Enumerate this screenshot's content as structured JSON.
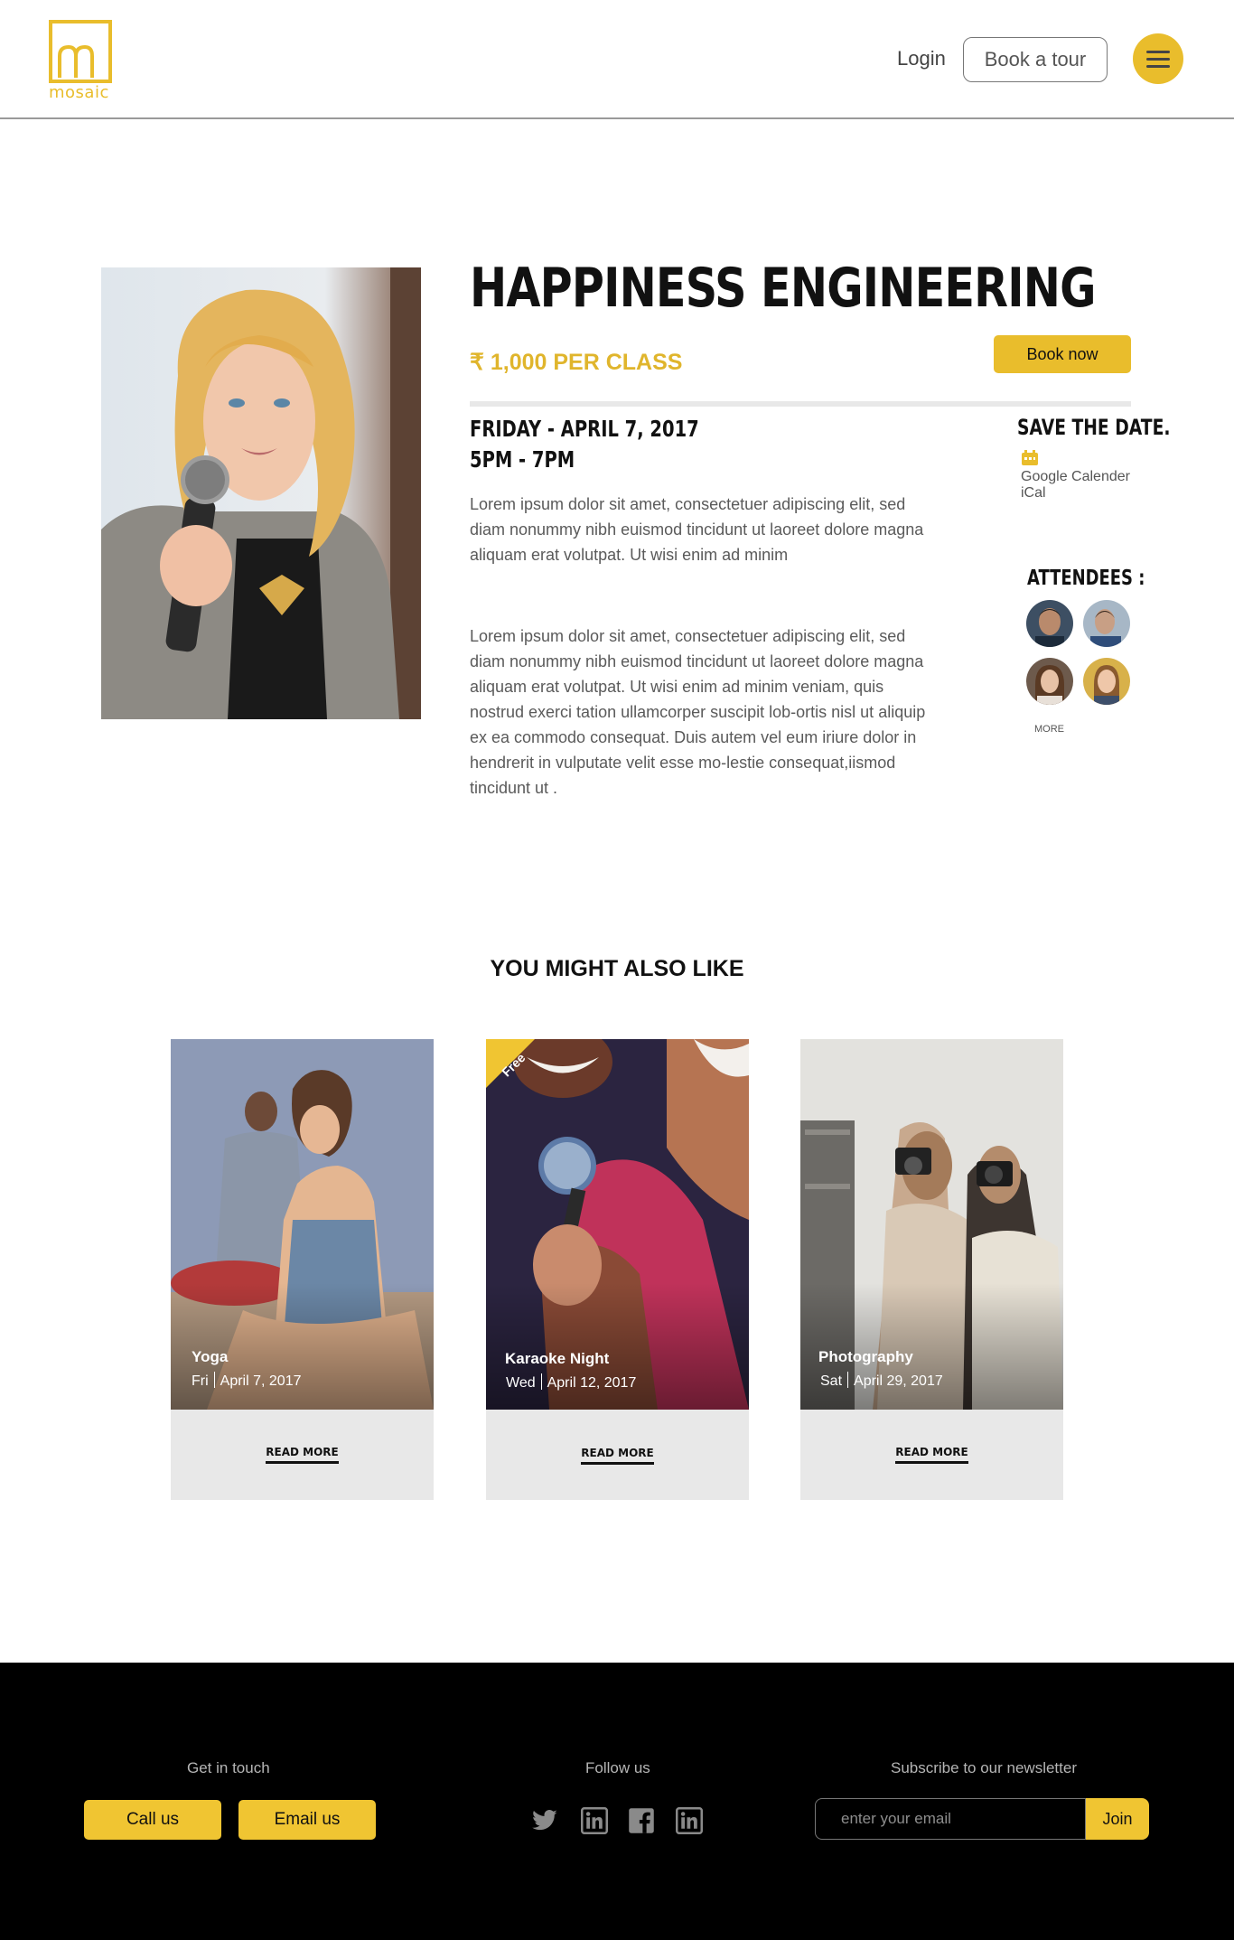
{
  "header": {
    "logo_text": "mosaic",
    "login_label": "Login",
    "book_tour_label": "Book a tour",
    "menu_icon": "hamburger-icon"
  },
  "event": {
    "title": "HAPPINESS ENGINEERING",
    "price": "₹ 1,000 PER CLASS",
    "book_now_label": "Book now",
    "date": "FRIDAY - APRIL 7, 2017",
    "time": "5PM - 7PM",
    "description_1": "Lorem ipsum dolor sit amet, consectetuer adipiscing elit, sed diam nonummy nibh euismod tincidunt ut laoreet dolore magna aliquam erat volutpat. Ut wisi enim ad minim",
    "description_2": "Lorem ipsum dolor sit amet, consectetuer adipiscing elit, sed diam nonummy nibh euismod tincidunt ut laoreet dolore magna aliquam erat volutpat. Ut wisi enim ad minim veniam, quis nostrud exerci tation ullamcorper suscipit lob-ortis nisl ut aliquip ex ea commodo consequat. Duis autem vel eum iriure dolor in hendrerit in vulputate velit esse mo-lestie consequat,iismod tincidunt ut .",
    "photo_icon": "speaker-with-microphone-photo"
  },
  "save_date": {
    "title": "SAVE THE DATE.",
    "calendar_icon": "calendar-icon",
    "google_label": "Google Calender",
    "ical_label": "iCal"
  },
  "attendees": {
    "title": "ATTENDEES :",
    "more_label": "MORE"
  },
  "also_like": {
    "title": "YOU MIGHT ALSO LIKE",
    "cards": [
      {
        "name": "Yoga",
        "day": "Fri",
        "date": "April 7, 2017",
        "read_more": "READ MORE"
      },
      {
        "name": "Karaoke Night",
        "day": "Wed",
        "date": "April 12, 2017",
        "read_more": "READ MORE",
        "badge": "Free"
      },
      {
        "name": "Photography",
        "day": "Sat",
        "date": "April 29, 2017",
        "read_more": "READ MORE"
      }
    ]
  },
  "footer": {
    "get_in_touch": "Get in touch",
    "call_label": "Call us",
    "email_label": "Email us",
    "follow_us": "Follow us",
    "social_icons": [
      "twitter-icon",
      "linkedin-icon",
      "facebook-icon",
      "linkedin-icon"
    ],
    "newsletter_title": "Subscribe to our newsletter",
    "email_placeholder": "enter your email",
    "join_label": "Join"
  },
  "colors": {
    "accent": "#e9bd2c",
    "footer_bg": "#000000",
    "card_bg": "#e8e8e8"
  }
}
